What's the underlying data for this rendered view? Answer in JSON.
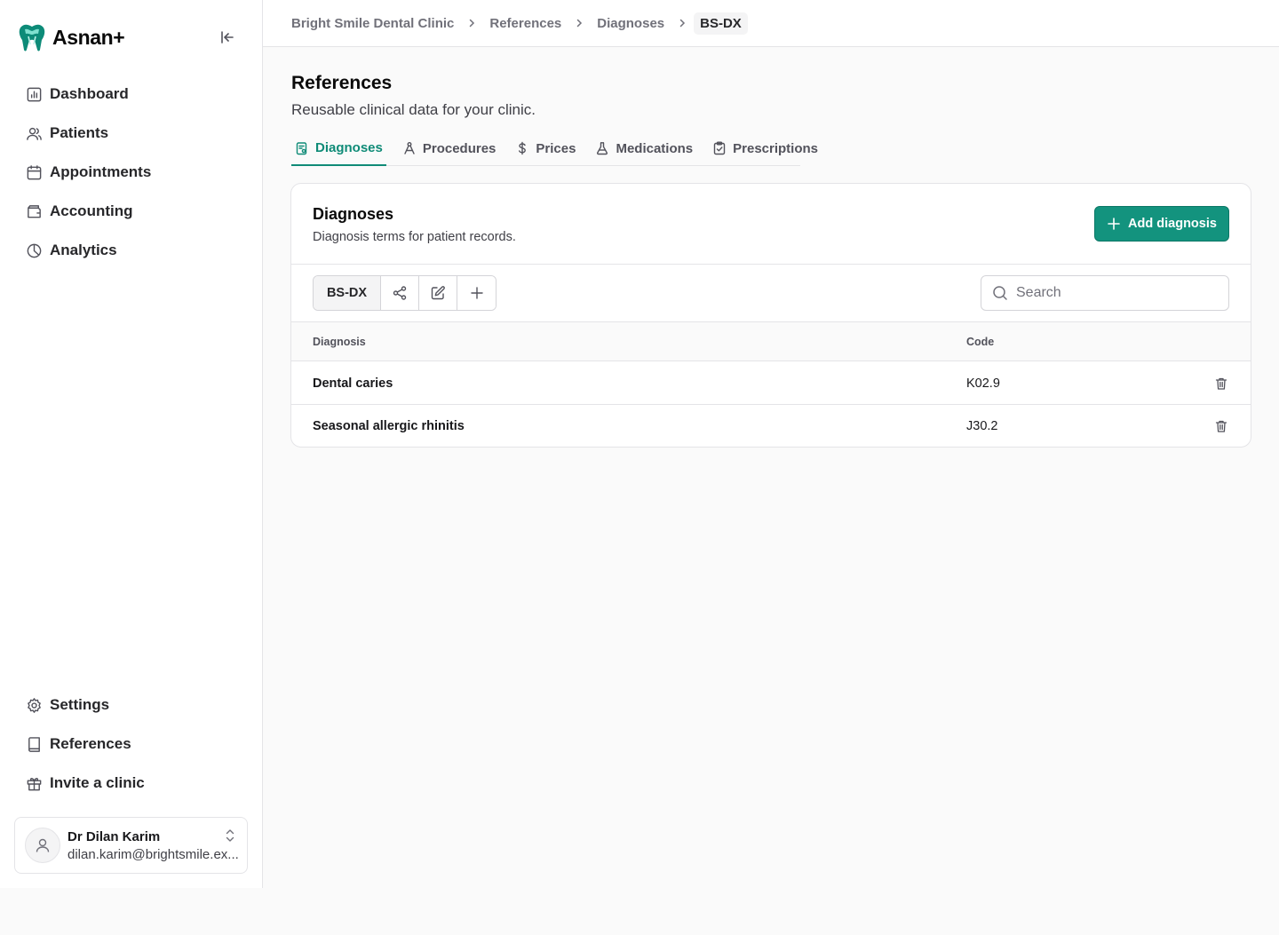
{
  "app": {
    "name": "Asnan+"
  },
  "colors": {
    "accent": "#13937e",
    "accent_text": "#0f8b77"
  },
  "sidebar": {
    "top_items": [
      {
        "label": "Dashboard",
        "icon": "dashboard-icon"
      },
      {
        "label": "Patients",
        "icon": "users-icon"
      },
      {
        "label": "Appointments",
        "icon": "calendar-icon"
      },
      {
        "label": "Accounting",
        "icon": "wallet-icon"
      },
      {
        "label": "Analytics",
        "icon": "pie-chart-icon"
      }
    ],
    "bottom_items": [
      {
        "label": "Settings",
        "icon": "gear-icon"
      },
      {
        "label": "References",
        "icon": "book-icon"
      },
      {
        "label": "Invite a clinic",
        "icon": "gift-icon"
      }
    ],
    "user": {
      "name": "Dr Dilan Karim",
      "email": "dilan.karim@brightsmile.ex..."
    }
  },
  "breadcrumb": [
    "Bright Smile Dental Clinic",
    "References",
    "Diagnoses",
    "BS-DX"
  ],
  "page": {
    "title": "References",
    "subtitle": "Reusable clinical data for your clinic.",
    "tabs": [
      {
        "label": "Diagnoses",
        "icon": "clipboard-list-icon",
        "active": true
      },
      {
        "label": "Procedures",
        "icon": "procedure-icon",
        "active": false
      },
      {
        "label": "Prices",
        "icon": "dollar-icon",
        "active": false
      },
      {
        "label": "Medications",
        "icon": "flask-icon",
        "active": false
      },
      {
        "label": "Prescriptions",
        "icon": "clipboard-check-icon",
        "active": false
      }
    ]
  },
  "card": {
    "title": "Diagnoses",
    "subtitle": "Diagnosis terms for patient records.",
    "add_button": "Add diagnosis",
    "set_code": "BS-DX",
    "search_placeholder": "Search",
    "columns": [
      "Diagnosis",
      "Code"
    ],
    "rows": [
      {
        "name": "Dental caries",
        "code": "K02.9"
      },
      {
        "name": "Seasonal allergic rhinitis",
        "code": "J30.2"
      }
    ]
  }
}
